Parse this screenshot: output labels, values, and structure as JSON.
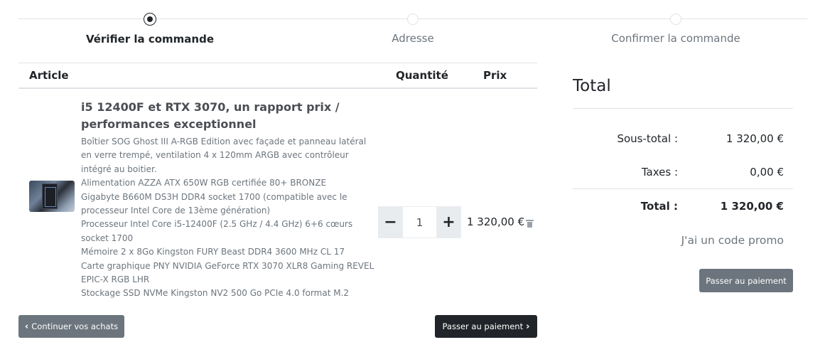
{
  "steps": [
    {
      "label": "Vérifier la commande",
      "active": true
    },
    {
      "label": "Adresse",
      "active": false
    },
    {
      "label": "Confirmer la commande",
      "active": false
    }
  ],
  "table": {
    "headers": {
      "article": "Article",
      "quantity": "Quantité",
      "price": "Prix"
    }
  },
  "item": {
    "title": "i5 12400F et RTX 3070, un rapport prix / performances exceptionnel",
    "details": [
      "Boîtier SOG Ghost III A-RGB Edition avec façade et panneau latéral en verre trempé, ventilation 4 x 120mm ARGB avec contrôleur intégré au boitier.",
      "Alimentation AZZA ATX 650W RGB certifiée 80+ BRONZE",
      "Gigabyte B660M DS3H DDR4 socket 1700 (compatible avec le processeur Intel Core de 13ème génération)",
      "Processeur Intel Core i5-12400F (2.5 GHz / 4.4 GHz) 6+6 cœurs socket 1700",
      "Mémoire 2 x 8Go Kingston FURY Beast DDR4 3600 MHz CL 17",
      "Carte graphique PNY NVIDIA GeForce RTX 3070 XLR8 Gaming REVEL EPIC-X RGB LHR",
      "Stockage SSD NVMe Kingston NV2 500 Go PCIe 4.0 format M.2"
    ],
    "quantity": "1",
    "decrement_label": "−",
    "increment_label": "+",
    "price": "1 320,00 €"
  },
  "actions": {
    "continue_label": "Continuer vos achats",
    "pay_label": "Passer au paiement"
  },
  "summary": {
    "title": "Total",
    "subtotal_label": "Sous-total :",
    "subtotal_value": "1 320,00 €",
    "taxes_label": "Taxes :",
    "taxes_value": "0,00 €",
    "total_label": "Total :",
    "total_value": "1 320,00 €",
    "promo_label": "J'ai un code promo",
    "pay_label": "Passer au paiement"
  },
  "colors": {
    "primary_dark": "#212529",
    "secondary": "#6c757d",
    "border": "#dee2e6",
    "stepper_bg": "#e9ecef"
  }
}
